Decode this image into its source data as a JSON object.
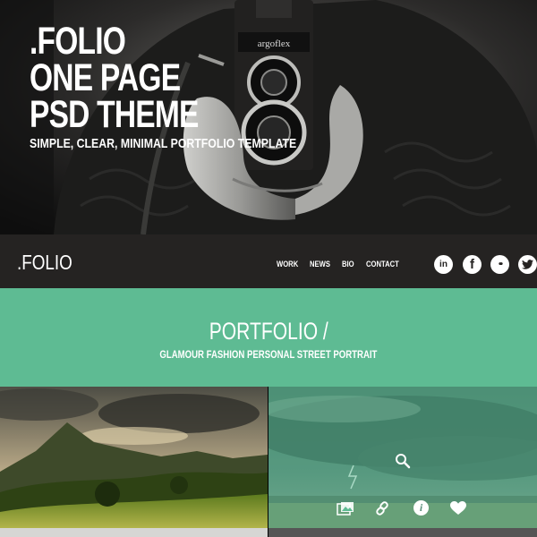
{
  "hero": {
    "title_lines": [
      ".FOLIO",
      "ONE PAGE",
      "PSD THEME"
    ],
    "subtitle": "SIMPLE, CLEAR, MINIMAL PORTFOLIO TEMPLATE",
    "camera_brand": "argoflex"
  },
  "nav": {
    "brand": ".FOLIO",
    "menu": [
      "WORK",
      "NEWS",
      "BIO",
      "CONTACT"
    ],
    "social": [
      {
        "name": "linkedin",
        "glyph": "in"
      },
      {
        "name": "facebook",
        "glyph": "f"
      },
      {
        "name": "flickr",
        "glyph": "••"
      },
      {
        "name": "twitter",
        "glyph": "t"
      }
    ]
  },
  "portfolio": {
    "title": "PORTFOLIO /",
    "filters": "GLAMOUR FASHION PERSONAL STREET PORTRAIT"
  },
  "colors": {
    "accent": "#5ebb93",
    "nav_bg": "#252322"
  },
  "overlay_icons": [
    "search-icon",
    "gallery-icon",
    "link-icon",
    "info-icon",
    "heart-icon"
  ]
}
